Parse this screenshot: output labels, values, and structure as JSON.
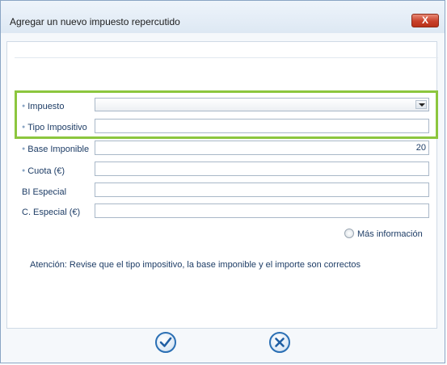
{
  "window": {
    "title": "Agregar un nuevo impuesto repercutido",
    "close_glyph": "X"
  },
  "form": {
    "impuesto_label": "Impuesto",
    "impuesto_value": "",
    "tipo_label": "Tipo Impositivo",
    "tipo_value": "",
    "base_label": "Base Imponible",
    "base_value": "20",
    "cuota_label": "Cuota (€)",
    "cuota_value": "",
    "bi_especial_label": "BI Especial",
    "bi_especial_value": "",
    "c_especial_label": "C. Especial (€)",
    "c_especial_value": ""
  },
  "more_info_label": "Más información",
  "notice": "Atención: Revise que el tipo impositivo, la base imponible y el importe son correctos",
  "icons": {
    "ok": "checkmark-icon",
    "cancel": "cancel-x-icon",
    "dropdown": "chevron-down-icon"
  },
  "colors": {
    "highlight": "#8cc63e",
    "accent_blue": "#2a6fb4",
    "close_red": "#c8402a"
  }
}
